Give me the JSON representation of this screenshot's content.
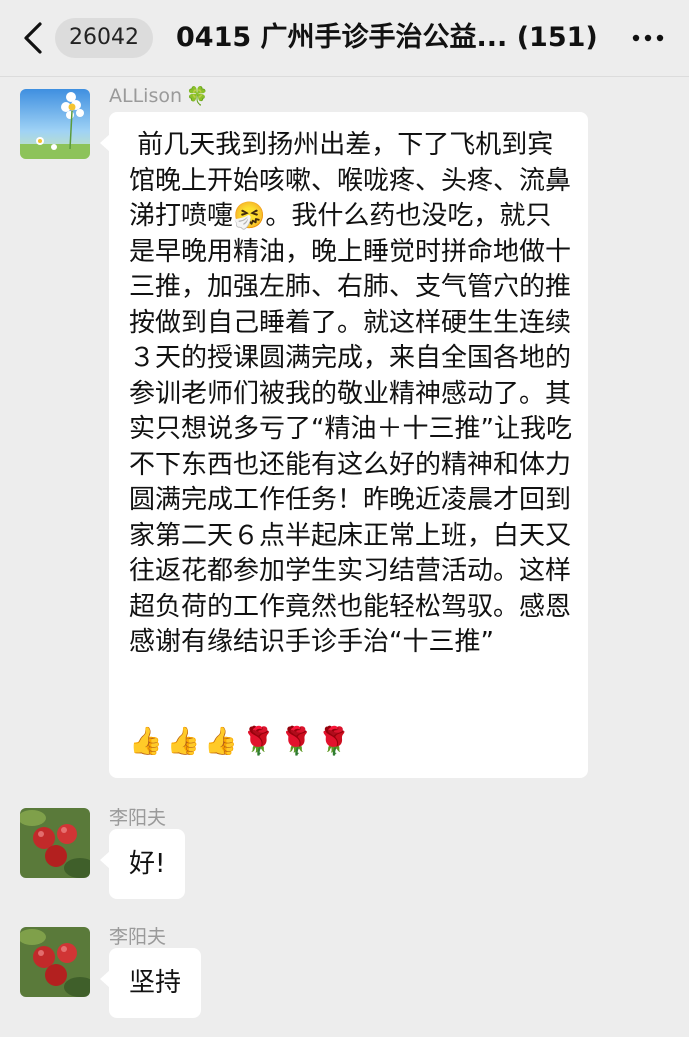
{
  "header": {
    "badge": "26042",
    "title": "0415 广州手诊手治公益... (151)"
  },
  "messages": [
    {
      "sender": "ALLison",
      "sender_suffix": "🍀",
      "text": " 前几天我到扬州出差，下了飞机到宾馆晚上开始咳嗽、喉咙疼、头疼、流鼻涕打喷嚏🤧。我什么药也没吃，就只是早晚用精油，晚上睡觉时拼命地做十三推，加强左肺、右肺、支气管穴的推按做到自己睡着了。就这样硬生生连续３天的授课圆满完成，来自全国各地的参训老师们被我的敬业精神感动了。其实只想说多亏了“精油＋十三推”让我吃不下东西也还能有这么好的精神和体力圆满完成工作任务！昨晚近凌晨才回到家第二天６点半起床正常上班，白天又往返花都参加学生实习结营活动。这样超负荷的工作竟然也能轻松驾驭。感恩感谢有缘结识手诊手治“十三推”",
      "emojis": "👍👍👍🌹🌹🌹"
    },
    {
      "sender": "李阳夫",
      "text": "好!"
    },
    {
      "sender": "李阳夫",
      "text": "坚持"
    }
  ]
}
